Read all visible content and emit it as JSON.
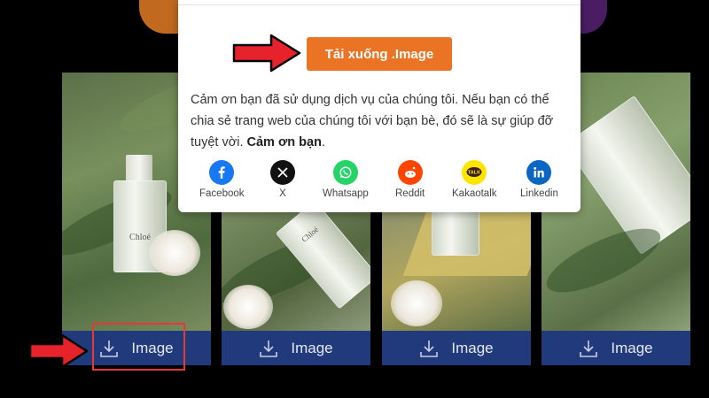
{
  "modal": {
    "download_button_label": "Tải xuống .Image",
    "thanks_text_part1": "Cảm ơn bạn đã sử dụng dịch vụ của chúng tôi. Nếu bạn có thể chia sẻ trang web của chúng tôi với bạn bè, đó sẽ là sự giúp đỡ tuyệt vời. ",
    "thanks_text_bold": "Cảm ơn bạn",
    "thanks_text_end": "."
  },
  "share": [
    {
      "label": "Facebook",
      "icon": "facebook-icon",
      "color": "#1877f2"
    },
    {
      "label": "X",
      "icon": "x-icon",
      "color": "#111111"
    },
    {
      "label": "Whatsapp",
      "icon": "whatsapp-icon",
      "color": "#25d366"
    },
    {
      "label": "Reddit",
      "icon": "reddit-icon",
      "color": "#ff4500"
    },
    {
      "label": "Kakaotalk",
      "icon": "kakaotalk-icon",
      "color": "#fee500"
    },
    {
      "label": "Linkedin",
      "icon": "linkedin-icon",
      "color": "#0a66c2"
    }
  ],
  "cards": [
    {
      "download_label": "Image",
      "bottle_text": "Chloé"
    },
    {
      "download_label": "Image",
      "bottle_text": "Chloé"
    },
    {
      "download_label": "Image"
    },
    {
      "download_label": "Image"
    }
  ],
  "colors": {
    "accent_orange": "#ea7424",
    "download_bar": "#213a7c",
    "highlight_red": "#e53935"
  }
}
